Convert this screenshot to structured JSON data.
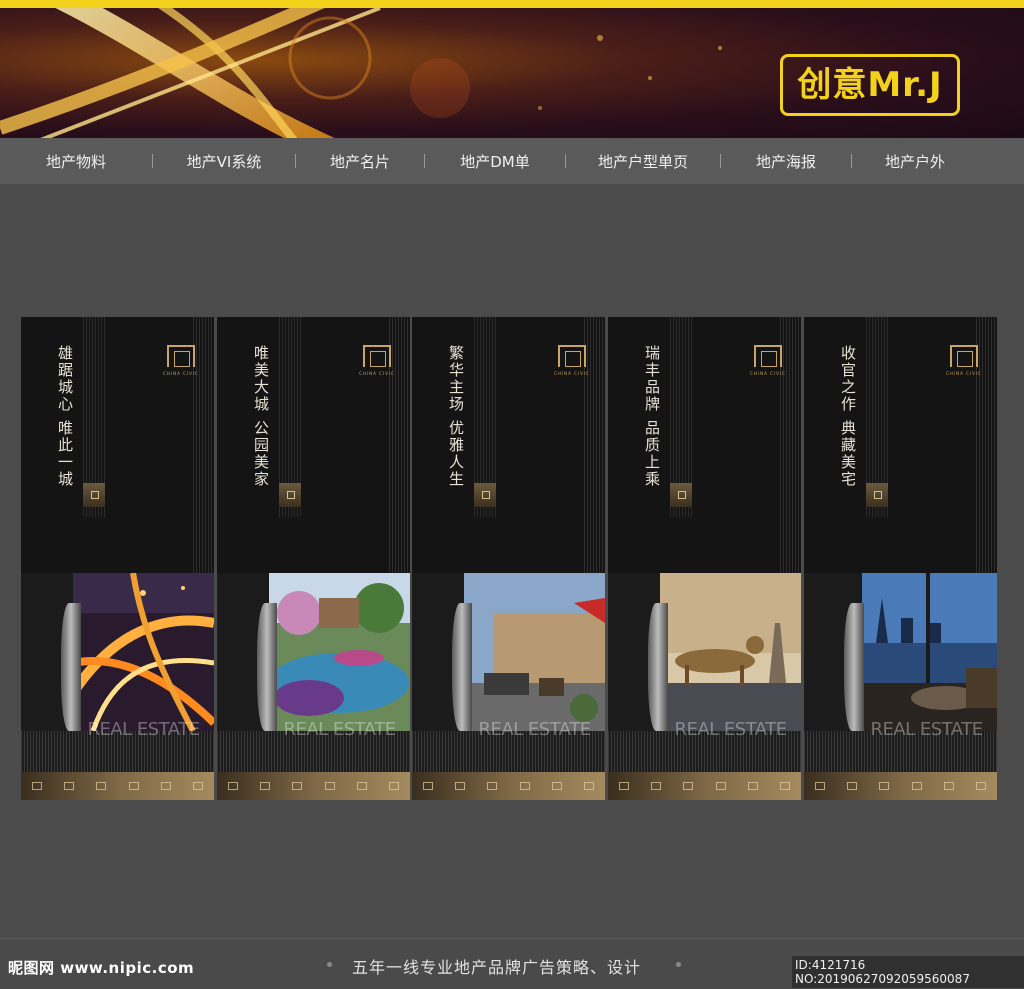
{
  "logo": {
    "text": "创意Mr.J"
  },
  "nav": {
    "items": [
      "地产物料",
      "地产VI系统",
      "地产名片",
      "地产DM单",
      "地产户型单页",
      "地产海报",
      "地产户外"
    ]
  },
  "posters": [
    {
      "title": "雄踞城心 唯此一城",
      "brand": "CHINA CIVIC",
      "re_text": "REAL ESTATE"
    },
    {
      "title": "唯美大城 公园美家",
      "brand": "CHINA CIVIC",
      "re_text": "REAL ESTATE"
    },
    {
      "title": "繁华主场 优雅人生",
      "brand": "CHINA CIVIC",
      "re_text": "REAL ESTATE"
    },
    {
      "title": "瑞丰品牌 品质上乘",
      "brand": "CHINA CIVIC",
      "re_text": "REAL ESTATE"
    },
    {
      "title": "收官之作 典藏美宅",
      "brand": "CHINA CIVIC",
      "re_text": "REAL ESTATE"
    }
  ],
  "footer": {
    "site": "昵图网 www.nipic.com",
    "slogan": "五年一线专业地产品牌广告策略、设计",
    "id": "ID:4121716 NO:20190627092059560087"
  },
  "colors": {
    "accent": "#f2d21a",
    "gold": "#c8a668",
    "nav_bg": "#5a5a5a",
    "page_bg": "#4b4b4b"
  }
}
